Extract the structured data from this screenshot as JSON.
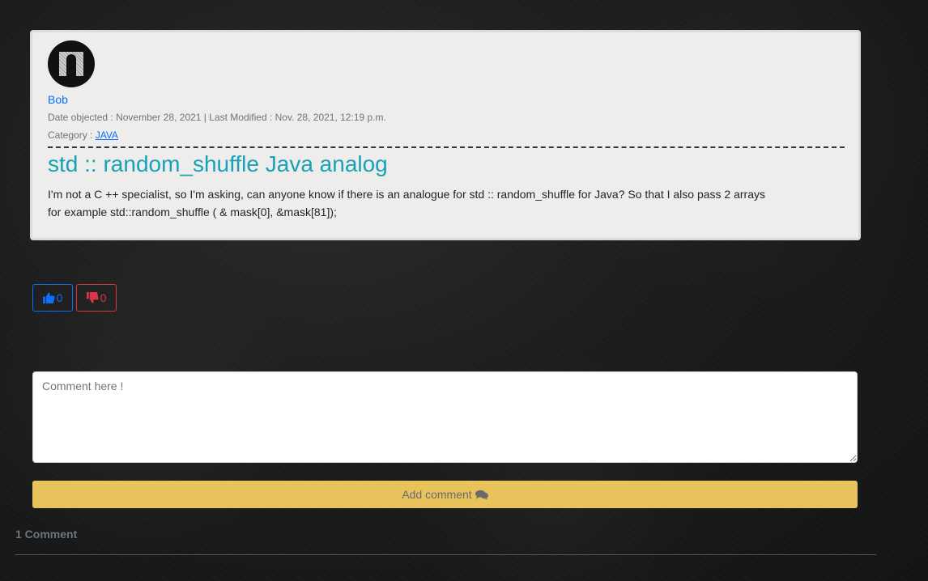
{
  "post": {
    "author": "Bob",
    "date_label": "Date objected : ",
    "date_value": "November 28, 2021",
    "separator": " | ",
    "modified_label": "Last Modified : ",
    "modified_value": "Nov. 28, 2021, 12:19 p.m.",
    "category_label": "Category : ",
    "category_value": "JAVA",
    "title": "std :: random_shuffle Java analog",
    "body_line1": "I'm not a C ++ specialist, so I'm asking, can anyone know if there is an analogue for std :: random_shuffle for Java? So that I also pass 2 arrays",
    "body_line2": "for example std::random_shuffle ( & mask[0], &mask[81]);"
  },
  "votes": {
    "likes": "0",
    "dislikes": "0"
  },
  "comment_form": {
    "placeholder": "Comment here !",
    "value": "",
    "submit_label": "Add comment"
  },
  "comments": {
    "count_label": "1 Comment"
  },
  "icons": {
    "like": "thumbs-up-icon",
    "dislike": "thumbs-down-icon",
    "comment": "comments-icon"
  },
  "colors": {
    "like": "#0d6efd",
    "dislike": "#dc3545",
    "title": "#17a2b8",
    "add_button": "#e8c35c",
    "card": "#eeedeb"
  }
}
